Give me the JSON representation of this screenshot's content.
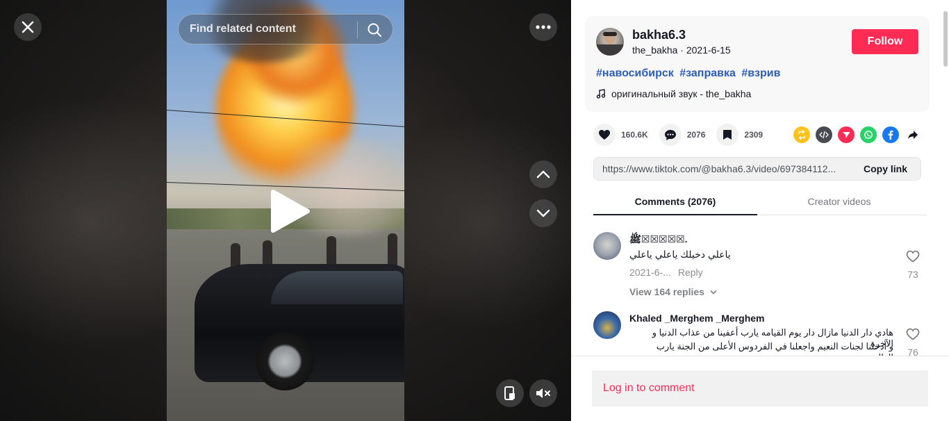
{
  "search": {
    "placeholder": "Find related content"
  },
  "author": {
    "username": "bakha6.3",
    "handle": "the_bakha",
    "separator": " · ",
    "date": "2021-6-15",
    "follow_label": "Follow"
  },
  "description": {
    "hashtags": [
      "#навосибирск",
      "#заправка",
      "#взрив"
    ],
    "music": "оригинальный звук - the_bakha"
  },
  "stats": {
    "likes": "160.6K",
    "comments": "2076",
    "saves": "2309"
  },
  "share_icons": [
    "repost-icon",
    "embed-icon",
    "send-icon",
    "whatsapp-icon",
    "facebook-icon",
    "share-arrow-icon"
  ],
  "link": {
    "url": "https://www.tiktok.com/@bakha6.3/video/697384112...",
    "copy_label": "Copy link"
  },
  "tabs": [
    {
      "label": "Comments (2076)",
      "active": true
    },
    {
      "label": "Creator videos",
      "active": false
    }
  ],
  "comments": [
    {
      "name": "ﷺ⁩☒☒☒☒☒.",
      "text": "ياعلي دخيلك ياعلي ياعلي",
      "date": "2021-6-...",
      "reply_label": "Reply",
      "likes": "73",
      "view_replies": "View 164 replies"
    },
    {
      "name": "Khaled _Merghem _Merghem",
      "text_line1": "هادي دار الدنيا مازال دار يوم القيامه يارب أعفينا من عذاب الدنيا و الآخرة",
      "text_line2": "و أدخلنا لجنات النعيم واجعلنا في الفردوس الأعلى من الجنة يارب العالمين.",
      "likes": "76"
    }
  ],
  "login_prompt": "Log in to comment",
  "colors": {
    "accent": "#fe2c55",
    "hashtag": "#2b5db9"
  }
}
